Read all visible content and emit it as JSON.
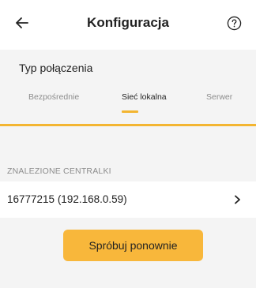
{
  "header": {
    "title": "Konfiguracja",
    "back_icon": "arrow-left-icon",
    "help_icon": "question-circle-icon"
  },
  "connection": {
    "title": "Typ połączenia",
    "tabs": [
      {
        "label": "Bezpośrednie",
        "active": false
      },
      {
        "label": "Sieć lokalna",
        "active": true
      },
      {
        "label": "Serwer",
        "active": false
      }
    ]
  },
  "found": {
    "label": "ZNALEZIONE CENTRALKI",
    "devices": [
      {
        "name": "16777215 (192.168.0.59)"
      }
    ]
  },
  "retry_label": "Spróbuj ponownie",
  "colors": {
    "accent": "#f3b531",
    "button": "#f8b73b",
    "background": "#f4f4f4"
  }
}
